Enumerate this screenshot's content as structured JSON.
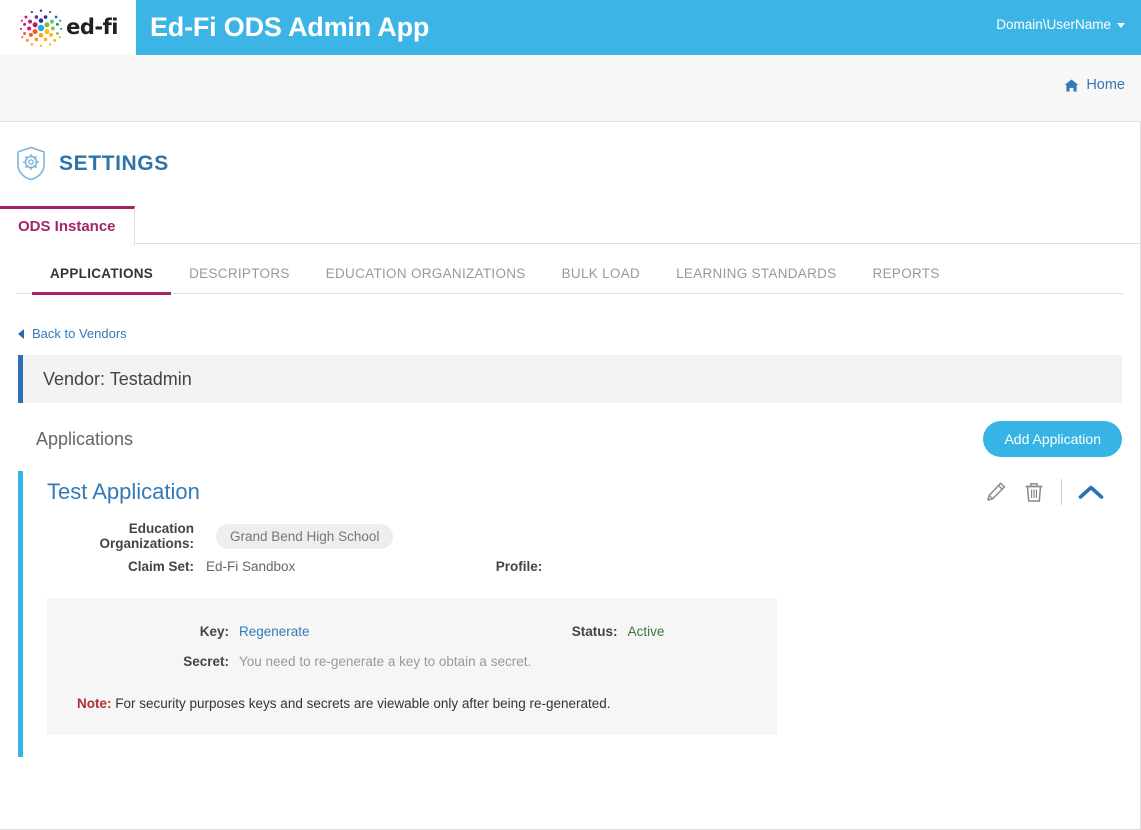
{
  "header": {
    "logo_text": "ed-fi",
    "logo_icon": "edfi-swirl-logo",
    "app_title": "Ed-Fi ODS Admin App",
    "user_label": "Domain\\UserName",
    "caret_icon": "chevron-down-icon",
    "brand_blue": "#3cb4e5"
  },
  "subheader": {
    "home_label": "Home",
    "home_icon": "home-icon",
    "link_color": "#337ab7"
  },
  "settings": {
    "icon": "shield-gear-icon",
    "title": "SETTINGS",
    "title_color": "#2e74a8"
  },
  "instance_tabs": [
    {
      "label": "ODS Instance",
      "active": true
    }
  ],
  "section_tabs": [
    {
      "label": "APPLICATIONS",
      "active": true
    },
    {
      "label": "DESCRIPTORS",
      "active": false
    },
    {
      "label": "EDUCATION ORGANIZATIONS",
      "active": false
    },
    {
      "label": "BULK LOAD",
      "active": false
    },
    {
      "label": "LEARNING STANDARDS",
      "active": false
    },
    {
      "label": "REPORTS",
      "active": false
    }
  ],
  "back_link": {
    "label": "Back to Vendors",
    "icon": "chevron-left-icon"
  },
  "vendor": {
    "title": "Vendor: Testadmin",
    "accent_color": "#2a72b5"
  },
  "applications_section": {
    "title": "Applications",
    "add_button_label": "Add Application",
    "add_button_color": "#36b4e5"
  },
  "application": {
    "name": "Test Application",
    "accent_color": "#36b4e5",
    "actions": {
      "edit_icon": "pencil-icon",
      "delete_icon": "trash-icon",
      "collapse_icon": "chevron-up-icon"
    },
    "details": {
      "education_organizations_label": "Education Organizations:",
      "education_organizations_value": "Grand Bend High School",
      "claim_set_label": "Claim Set:",
      "claim_set_value": "Ed-Fi Sandbox",
      "profile_label": "Profile:",
      "profile_value": ""
    },
    "credentials": {
      "key_label": "Key:",
      "key_action": "Regenerate",
      "status_label": "Status:",
      "status_value": "Active",
      "status_color": "#3c763d",
      "secret_label": "Secret:",
      "secret_value": "You need to re-generate a key to obtain a secret.",
      "note_prefix": "Note:",
      "note_text": " For security purposes keys and secrets are viewable only after being re-generated."
    }
  }
}
